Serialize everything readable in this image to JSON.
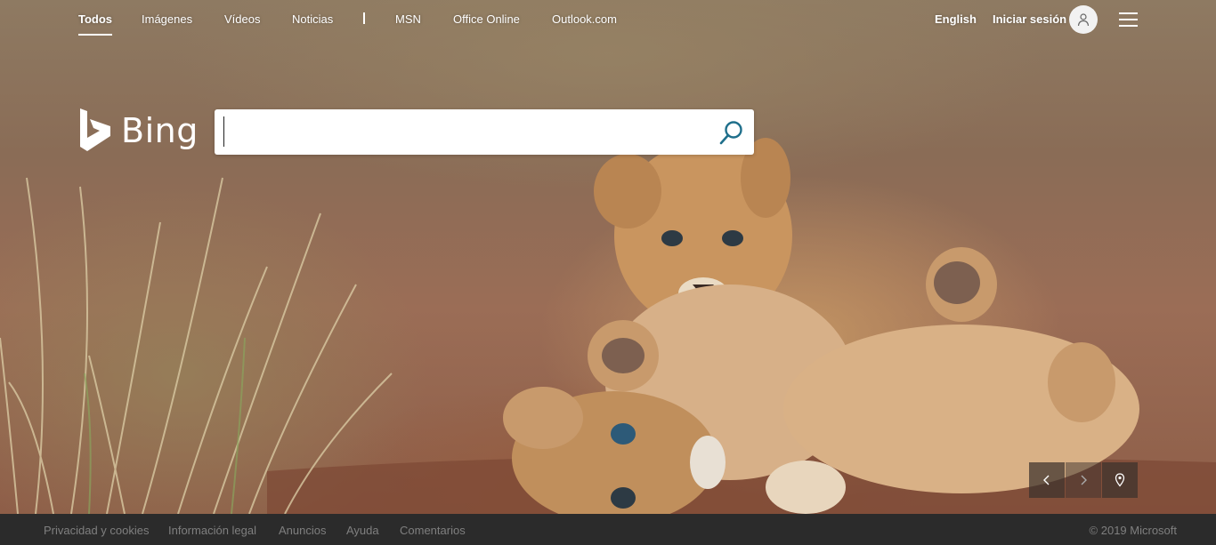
{
  "nav": {
    "items": [
      {
        "label": "Todos",
        "active": true
      },
      {
        "label": "Imágenes",
        "active": false
      },
      {
        "label": "Vídeos",
        "active": false
      },
      {
        "label": "Noticias",
        "active": false
      },
      {
        "label": "MSN",
        "active": false
      },
      {
        "label": "Office Online",
        "active": false
      },
      {
        "label": "Outlook.com",
        "active": false
      }
    ],
    "language": "English",
    "signin": "Iniciar sesión"
  },
  "brand": {
    "name": "Bing",
    "color": "#ffffff"
  },
  "search": {
    "value": "",
    "placeholder": ""
  },
  "colors": {
    "search_icon": "#1f6f8b",
    "footer_bg": "#2b2b2b",
    "footer_text": "#7f7f7f"
  },
  "icons": {
    "avatar": "user-icon",
    "menu": "hamburger-icon",
    "search": "search-icon",
    "prev": "chevron-left-icon",
    "next": "chevron-right-icon",
    "location": "location-pin-icon"
  },
  "footer": {
    "links": [
      "Privacidad y cookies",
      "Información legal",
      "Anuncios",
      "Ayuda",
      "Comentarios"
    ],
    "copyright": "© 2019 Microsoft"
  }
}
